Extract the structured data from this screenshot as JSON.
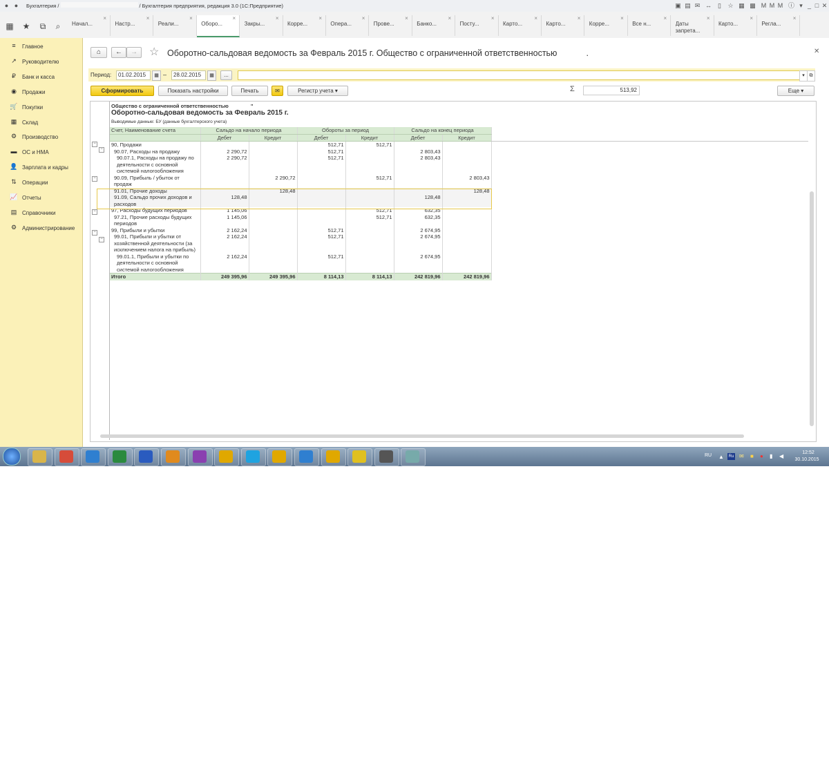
{
  "window": {
    "title_left": "Бухгалтерия /",
    "title_right": "/ Бухгалтерия предприятия, редакция 3.0  (1С:Предприятие)"
  },
  "tabs": [
    {
      "label": "Начал..."
    },
    {
      "label": "Настр..."
    },
    {
      "label": "Реали..."
    },
    {
      "label": "Оборо..."
    },
    {
      "label": "Закры..."
    },
    {
      "label": "Корре..."
    },
    {
      "label": "Опера..."
    },
    {
      "label": "Прове..."
    },
    {
      "label": "Банко..."
    },
    {
      "label": "Посту..."
    },
    {
      "label": "Карто..."
    },
    {
      "label": "Карто..."
    },
    {
      "label": "Корре..."
    },
    {
      "label": "Все н..."
    },
    {
      "label": "Даты запрета..."
    },
    {
      "label": "Карто..."
    },
    {
      "label": "Регла..."
    }
  ],
  "sidebar": {
    "items": [
      {
        "label": "Главное",
        "icon": "≡"
      },
      {
        "label": "Руководителю",
        "icon": "↗"
      },
      {
        "label": "Банк и касса",
        "icon": "₽"
      },
      {
        "label": "Продажи",
        "icon": "◉"
      },
      {
        "label": "Покупки",
        "icon": "🛒"
      },
      {
        "label": "Склад",
        "icon": "▦"
      },
      {
        "label": "Производство",
        "icon": "⚙"
      },
      {
        "label": "ОС и НМА",
        "icon": "▬"
      },
      {
        "label": "Зарплата и кадры",
        "icon": "👤"
      },
      {
        "label": "Операции",
        "icon": "⇅"
      },
      {
        "label": "Отчеты",
        "icon": "📈"
      },
      {
        "label": "Справочники",
        "icon": "▤"
      },
      {
        "label": "Администрирование",
        "icon": "⚙"
      }
    ]
  },
  "report": {
    "title": "Оборотно-сальдовая ведомость за Февраль 2015 г. Общество с ограниченной ответственностью",
    "title_tail": "."
  },
  "filters": {
    "period_label": "Период:",
    "date_from": "01.02.2015",
    "date_to": "28.02.2015",
    "dash": "–",
    "more": "...",
    "org_value": ""
  },
  "toolbar": {
    "generate": "Сформировать",
    "show_settings": "Показать настройки",
    "print": "Печать",
    "register": "Регистр учета",
    "sum_sign": "Σ",
    "sum_value": "513,92",
    "more": "Еще"
  },
  "sheet": {
    "org_line": "Общество с ограниченной ответственностью",
    "org_suffix": "\"",
    "heading": "Оборотно-сальдовая ведомость за Февраль 2015 г.",
    "output": "Выводимые данные:  БУ (данные бухгалтерского учета)",
    "col_account": "Счет, Наименование счета",
    "col_open": "Сальдо на начало периода",
    "col_turn": "Обороты за период",
    "col_close": "Сальдо на конец периода",
    "debit": "Дебет",
    "credit": "Кредит",
    "rows": [
      {
        "name": "90, Продажи",
        "d1": "",
        "c1": "",
        "d2": "512,71",
        "c2": "512,71",
        "d3": "",
        "c3": ""
      },
      {
        "name": "90.07, Расходы на продажу",
        "d1": "2 290,72",
        "c1": "",
        "d2": "512,71",
        "c2": "",
        "d3": "2 803,43",
        "c3": ""
      },
      {
        "name": "90.07.1, Расходы на продажу по деятельности с основной системой налогообложения",
        "d1": "2 290,72",
        "c1": "",
        "d2": "512,71",
        "c2": "",
        "d3": "2 803,43",
        "c3": ""
      },
      {
        "name": "90.09, Прибыль / убыток от продаж",
        "d1": "",
        "c1": "2 290,72",
        "d2": "",
        "c2": "512,71",
        "d3": "",
        "c3": "2 803,43"
      },
      {
        "name": "91.01, Прочие доходы",
        "d1": "",
        "c1": "128,48",
        "d2": "",
        "c2": "",
        "d3": "",
        "c3": "128,48"
      },
      {
        "name": "91.09, Сальдо прочих доходов и расходов",
        "d1": "128,48",
        "c1": "",
        "d2": "",
        "c2": "",
        "d3": "128,48",
        "c3": ""
      },
      {
        "name": "97, Расходы будущих периодов",
        "d1": "1 145,06",
        "c1": "",
        "d2": "",
        "c2": "512,71",
        "d3": "632,35",
        "c3": ""
      },
      {
        "name": "97.21, Прочие расходы будущих периодов",
        "d1": "1 145,06",
        "c1": "",
        "d2": "",
        "c2": "512,71",
        "d3": "632,35",
        "c3": ""
      },
      {
        "name": "99, Прибыли и убытки",
        "d1": "2 162,24",
        "c1": "",
        "d2": "512,71",
        "c2": "",
        "d3": "2 674,95",
        "c3": ""
      },
      {
        "name": "99.01, Прибыли и убытки от хозяйственной деятельности (за исключением налога на прибыль)",
        "d1": "2 162,24",
        "c1": "",
        "d2": "512,71",
        "c2": "",
        "d3": "2 674,95",
        "c3": ""
      },
      {
        "name": "99.01.1, Прибыли и убытки по деятельности с основной системой налогообложения",
        "d1": "2 162,24",
        "c1": "",
        "d2": "512,71",
        "c2": "",
        "d3": "2 674,95",
        "c3": ""
      }
    ],
    "total": {
      "name": "Итого",
      "d1": "249 395,96",
      "c1": "249 395,96",
      "d2": "8 114,13",
      "c2": "8 114,13",
      "d3": "242 819,96",
      "c3": "242 819,96"
    }
  },
  "taskbar": {
    "lang": "RU",
    "lang2": "Ru",
    "time": "12:52",
    "date": "30.10.2015",
    "apps": [
      "Explorer",
      "Chrome",
      "IE",
      "Excel",
      "Word",
      "Media",
      "WinRAR",
      "1С",
      "Skype",
      "Outlook",
      "IE",
      "1С",
      "Smile",
      "Calendar",
      "Paint"
    ]
  }
}
